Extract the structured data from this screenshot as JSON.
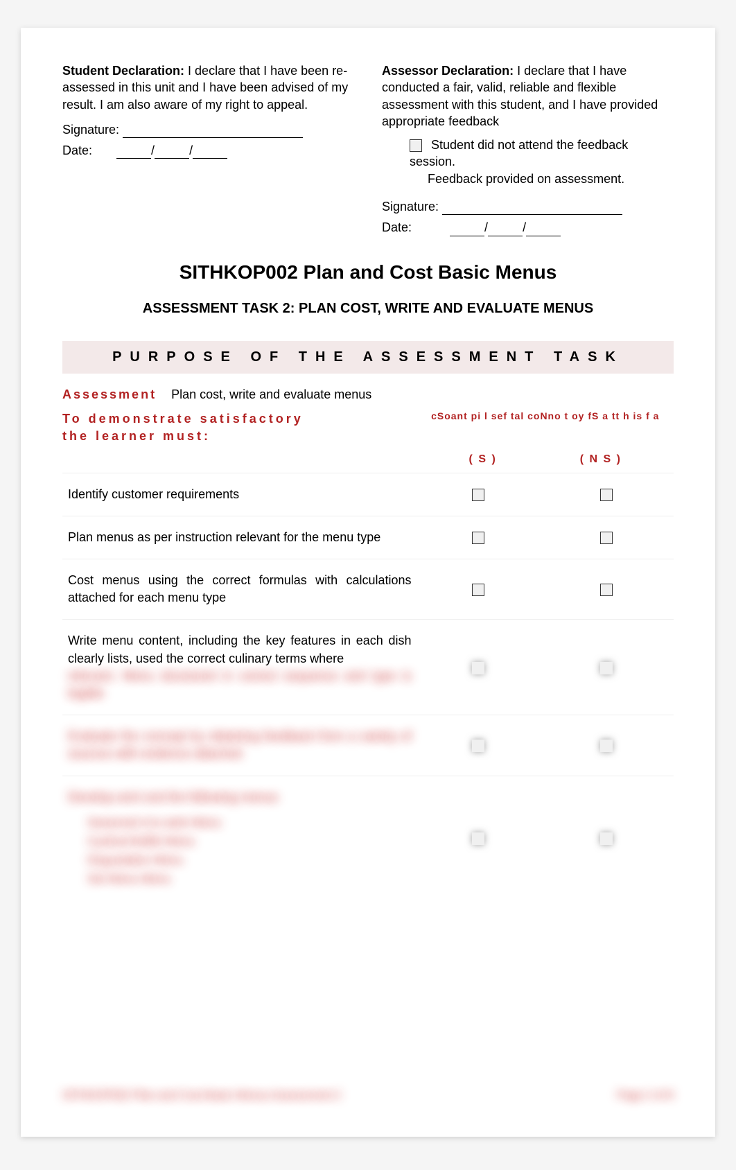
{
  "declarations": {
    "student": {
      "label": "Student Declaration:",
      "text": "I declare that I have been re-assessed in this unit and I have been advised of my result. I am also aware of my right to appeal.",
      "signature_label": "Signature:",
      "date_label": "Date:"
    },
    "assessor": {
      "label": "Assessor Declaration:",
      "text": "I declare that I have conducted a fair, valid, reliable and flexible assessment with this student, and I have provided appropriate feedback",
      "note1": "Student did not attend the feedback session.",
      "note2": "Feedback provided on assessment.",
      "signature_label": "Signature:",
      "date_label": "Date:"
    }
  },
  "unit": {
    "code_title": "SITHKOP002 Plan and Cost Basic Menus",
    "task_title": "ASSESSMENT TASK 2:  PLAN COST, WRITE AND EVALUATE MENUS"
  },
  "purpose": {
    "heading": "PURPOSE OF THE ASSESSMENT TASK",
    "assess_prefix": "Assessment",
    "assess_mid": "Plan cost",
    "assess_suffix": ", write and evaluate menus",
    "criteria_intro_line1": "To demonstrate satisfactory",
    "criteria_intro_line2": "the learner must:",
    "garbled_header": "cSoant pi l sef tal coNno t oy fS a tt h is f a",
    "s_label": "( S )",
    "ns_label": "( N S )"
  },
  "criteria": [
    {
      "text": "Identify customer requirements",
      "blurred": false
    },
    {
      "text": "Plan menus as per instruction relevant for the menu type",
      "blurred": false
    },
    {
      "text": "Cost menus using the correct formulas  with calculations attached for each menu type",
      "blurred": false
    },
    {
      "text": "Write menu content, including the key features in each dish clearly lists, used the correct culinary terms where",
      "blurred": false,
      "blurred_tail": "relevant. Menu structured in correct sequence and type is legible"
    },
    {
      "blurred_full": "Evaluate the concept by obtaining feedback from a variety of sources with evidence attached",
      "blurred": true
    },
    {
      "blurred_full": "Develop and cost the following menus",
      "blurred": true,
      "sublist": [
        "Seasonal à la carte Menu",
        "Cyclical Buffet Menu",
        "Degustation Menu",
        "Set Menu Menu"
      ]
    }
  ],
  "footer": {
    "left": "SITHKOP002 Plan and Cost Basic Menus Assessment 2",
    "right": "Page 2 of 8"
  }
}
